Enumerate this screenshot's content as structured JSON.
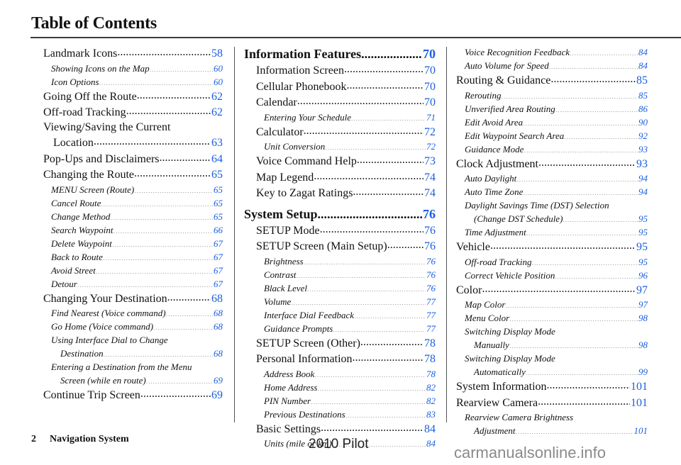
{
  "header": {
    "title": "Table of Contents"
  },
  "colors": {
    "page_link": "#1a5fe0",
    "rule": "#3a3a3a"
  },
  "columns": [
    {
      "entries": [
        {
          "level": 1,
          "label": "Landmark Icons",
          "page": "58"
        },
        {
          "level": 2,
          "label": "Showing Icons on the Map",
          "page": "60"
        },
        {
          "level": 2,
          "label": "Icon Options",
          "page": "60"
        },
        {
          "level": 1,
          "label": "Going Off the Route",
          "page": "62"
        },
        {
          "level": 1,
          "label": "Off-road Tracking",
          "page": "62"
        },
        {
          "level": 1,
          "label": "Viewing/Saving the Current",
          "continuation": "Location",
          "page": "63"
        },
        {
          "level": 1,
          "label": "Pop-Ups and Disclaimers",
          "page": "64"
        },
        {
          "level": 1,
          "label": "Changing the Route",
          "page": "65"
        },
        {
          "level": 2,
          "label": "MENU Screen (Route)",
          "page": "65"
        },
        {
          "level": 2,
          "label": "Cancel Route",
          "page": "65"
        },
        {
          "level": 2,
          "label": "Change Method",
          "page": "65"
        },
        {
          "level": 2,
          "label": "Search Waypoint",
          "page": "66"
        },
        {
          "level": 2,
          "label": "Delete Waypoint",
          "page": "67"
        },
        {
          "level": 2,
          "label": "Back to Route",
          "page": "67"
        },
        {
          "level": 2,
          "label": "Avoid Street",
          "page": "67"
        },
        {
          "level": 2,
          "label": "Detour",
          "page": "67"
        },
        {
          "level": 1,
          "label": "Changing Your Destination",
          "page": "68"
        },
        {
          "level": 2,
          "label": "Find Nearest (Voice command)",
          "page": "68"
        },
        {
          "level": 2,
          "label": "Go Home (Voice command)",
          "page": "68"
        },
        {
          "level": 2,
          "label": "Using Interface Dial to Change",
          "continuation": "Destination",
          "page": "68"
        },
        {
          "level": 2,
          "label": "Entering a Destination from the Menu",
          "continuation": "Screen (while en route)",
          "page": "69"
        },
        {
          "level": 1,
          "label": "Continue Trip Screen",
          "page": "69"
        }
      ]
    },
    {
      "entries": [
        {
          "level": 0,
          "label": "Information Features",
          "page": "70"
        },
        {
          "level": 1,
          "label": "Information Screen",
          "page": "70"
        },
        {
          "level": 1,
          "label": "Cellular Phonebook",
          "page": "70"
        },
        {
          "level": 1,
          "label": "Calendar",
          "page": "70"
        },
        {
          "level": 2,
          "label": "Entering Your Schedule",
          "page": "71"
        },
        {
          "level": 1,
          "label": "Calculator",
          "page": "72"
        },
        {
          "level": 2,
          "label": "Unit Conversion",
          "page": "72"
        },
        {
          "level": 1,
          "label": "Voice Command Help",
          "page": "73"
        },
        {
          "level": 1,
          "label": "Map Legend",
          "page": "74"
        },
        {
          "level": 1,
          "label": "Key to Zagat Ratings",
          "page": "74"
        },
        {
          "level": 0,
          "label": "System Setup",
          "page": "76"
        },
        {
          "level": 1,
          "label": "SETUP Mode",
          "page": "76"
        },
        {
          "level": 1,
          "label": "SETUP Screen (Main Setup)",
          "page": "76"
        },
        {
          "level": 2,
          "label": "Brightness",
          "page": "76"
        },
        {
          "level": 2,
          "label": "Contrast",
          "page": "76"
        },
        {
          "level": 2,
          "label": "Black Level",
          "page": "76"
        },
        {
          "level": 2,
          "label": "Volume",
          "page": "77"
        },
        {
          "level": 2,
          "label": "Interface Dial Feedback",
          "page": "77"
        },
        {
          "level": 2,
          "label": "Guidance Prompts",
          "page": "77"
        },
        {
          "level": 1,
          "label": "SETUP Screen (Other)",
          "page": "78"
        },
        {
          "level": 1,
          "label": "Personal Information",
          "page": "78"
        },
        {
          "level": 2,
          "label": "Address Book",
          "page": "78"
        },
        {
          "level": 2,
          "label": "Home Address",
          "page": "82"
        },
        {
          "level": 2,
          "label": "PIN Number",
          "page": "82"
        },
        {
          "level": 2,
          "label": "Previous Destinations",
          "page": "83"
        },
        {
          "level": 1,
          "label": "Basic Settings",
          "page": "84"
        },
        {
          "level": 2,
          "label": "Units (mile or km)",
          "page": "84"
        }
      ]
    },
    {
      "entries": [
        {
          "level": 2,
          "label": "Voice Recognition Feedback",
          "page": "84"
        },
        {
          "level": 2,
          "label": "Auto Volume for Speed",
          "page": "84"
        },
        {
          "level": 1,
          "label": "Routing & Guidance",
          "page": "85"
        },
        {
          "level": 2,
          "label": "Rerouting",
          "page": "85"
        },
        {
          "level": 2,
          "label": "Unverified Area Routing",
          "page": "86"
        },
        {
          "level": 2,
          "label": "Edit Avoid Area",
          "page": "90"
        },
        {
          "level": 2,
          "label": "Edit Waypoint Search Area",
          "page": "92"
        },
        {
          "level": 2,
          "label": "Guidance Mode",
          "page": "93"
        },
        {
          "level": 1,
          "label": "Clock Adjustment",
          "page": "93"
        },
        {
          "level": 2,
          "label": "Auto Daylight",
          "page": "94"
        },
        {
          "level": 2,
          "label": "Auto Time Zone",
          "page": "94"
        },
        {
          "level": 2,
          "label": "Daylight Savings Time (DST) Selection",
          "continuation": "(Change DST Schedule)",
          "page": "95"
        },
        {
          "level": 2,
          "label": "Time Adjustment",
          "page": "95"
        },
        {
          "level": 1,
          "label": "Vehicle",
          "page": "95"
        },
        {
          "level": 2,
          "label": "Off-road Tracking",
          "page": "95"
        },
        {
          "level": 2,
          "label": "Correct Vehicle Position",
          "page": "96"
        },
        {
          "level": 1,
          "label": "Color",
          "page": "97"
        },
        {
          "level": 2,
          "label": "Map Color",
          "page": "97"
        },
        {
          "level": 2,
          "label": "Menu Color",
          "page": "98"
        },
        {
          "level": 2,
          "label": "Switching Display Mode",
          "continuation": "Manually",
          "page": "98"
        },
        {
          "level": 2,
          "label": "Switching Display Mode",
          "continuation": "Automatically",
          "page": "99"
        },
        {
          "level": 1,
          "label": "System Information",
          "page": "101"
        },
        {
          "level": 1,
          "label": "Rearview Camera",
          "page": "101"
        },
        {
          "level": 2,
          "label": "Rearview Camera Brightness",
          "continuation": "Adjustment",
          "page": "101"
        }
      ]
    }
  ],
  "footer": {
    "page_number": "2",
    "section": "Navigation System",
    "model": "2010 Pilot",
    "watermark": "carmanualsonline.info"
  }
}
